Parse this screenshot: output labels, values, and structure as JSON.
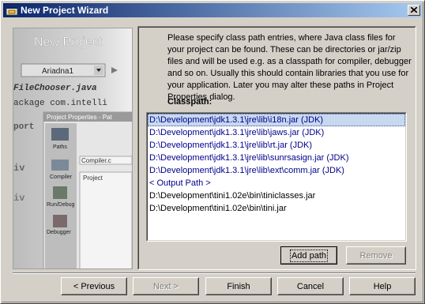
{
  "window": {
    "title": "New Project Wizard",
    "close_glyph": "✕"
  },
  "side_image": {
    "heading": "New Project",
    "combo_value": "Ariadna1",
    "lines": [
      "FileChooser.java",
      "ackage com.intelli",
      "port",
      "iv",
      "iv"
    ],
    "dialog_title": "Project Properties - Pat",
    "nav_items": [
      "Paths",
      "Compiler",
      "Run/Debug",
      "Debugger"
    ],
    "fields": [
      "Compiler.c",
      "Project"
    ]
  },
  "content": {
    "description": "Please specify class path entries, where Java class files for your project can be found. These can be directories or jar/zip files and will be used e.g. as a classpath for compiler, debugger and so on. Usually this should contain libraries that you use for your application. Later you may alter these paths in Project Properties dialog.",
    "classpath_label": "Classpath:",
    "classpath_entries": [
      {
        "text": "D:\\Development\\jdk1.3.1\\jre\\lib\\i18n.jar (JDK)",
        "kind": "jdk",
        "selected": true
      },
      {
        "text": "D:\\Development\\jdk1.3.1\\jre\\lib\\jaws.jar (JDK)",
        "kind": "jdk",
        "selected": false
      },
      {
        "text": "D:\\Development\\jdk1.3.1\\jre\\lib\\rt.jar (JDK)",
        "kind": "jdk",
        "selected": false
      },
      {
        "text": "D:\\Development\\jdk1.3.1\\jre\\lib\\sunrsasign.jar (JDK)",
        "kind": "jdk",
        "selected": false
      },
      {
        "text": "D:\\Development\\jdk1.3.1\\jre\\lib\\ext\\comm.jar (JDK)",
        "kind": "jdk",
        "selected": false
      },
      {
        "text": "< Output Path >",
        "kind": "jdk",
        "selected": false
      },
      {
        "text": "D:\\Development\\tini1.02e\\bin\\tiniclasses.jar",
        "kind": "plain",
        "selected": false
      },
      {
        "text": "D:\\Development\\tini1.02e\\bin\\tini.jar",
        "kind": "plain",
        "selected": false
      }
    ],
    "add_path_label": "Add path",
    "remove_label": "Remove"
  },
  "footer": {
    "previous_label": "< Previous",
    "next_label": "Next >",
    "finish_label": "Finish",
    "cancel_label": "Cancel",
    "help_label": "Help"
  },
  "colors": {
    "title_start": "#0a246a",
    "title_end": "#a6caf0",
    "selection": "#c7d9ef",
    "jdk_entry_text": "#00008b",
    "face": "#d4d0c8"
  },
  "icons": [
    "app-icon",
    "close-icon"
  ]
}
